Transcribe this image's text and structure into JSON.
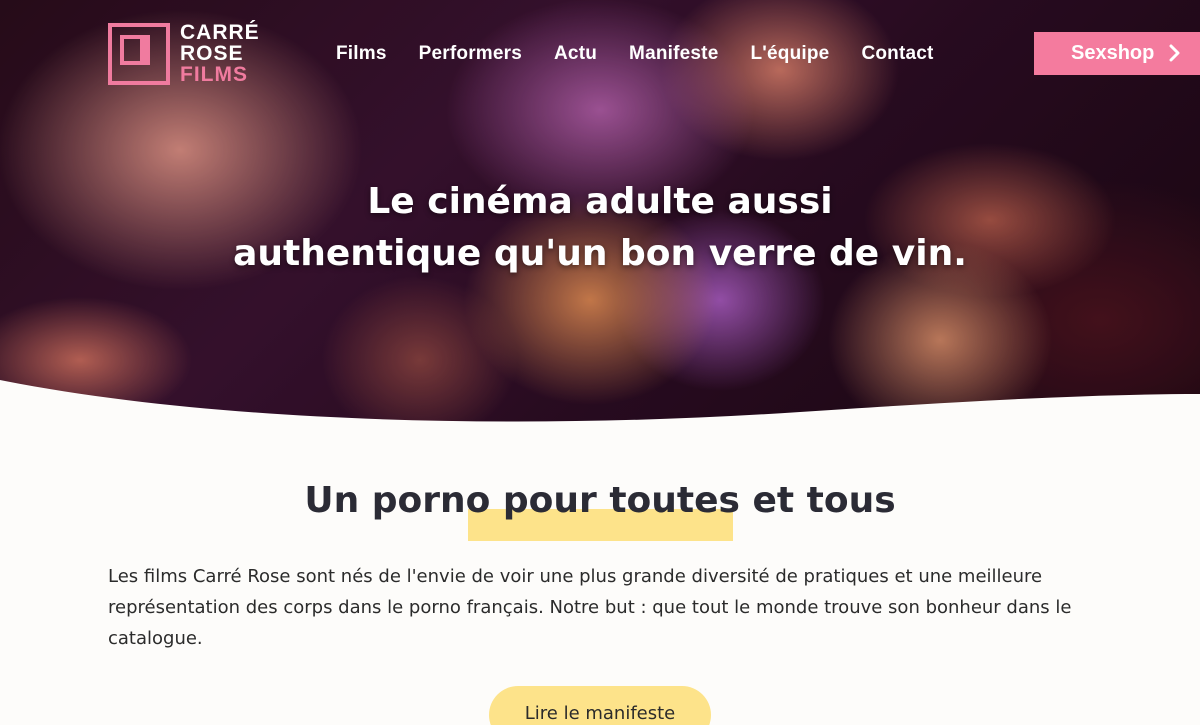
{
  "brand": {
    "line1": "CARRÉ",
    "line2": "ROSE",
    "line3": "FILMS",
    "accent_color": "#f47b9e"
  },
  "nav": {
    "items": [
      {
        "label": "Films"
      },
      {
        "label": "Performers"
      },
      {
        "label": "Actu"
      },
      {
        "label": "Manifeste"
      },
      {
        "label": "L'équipe"
      },
      {
        "label": "Contact"
      }
    ]
  },
  "shop_button": {
    "label": "Sexshop",
    "icon": "chevron-right-icon"
  },
  "hero": {
    "line1": "Le cinéma adulte aussi",
    "line2": "authentique qu'un bon verre de vin."
  },
  "section": {
    "title": "Un porno pour toutes et tous",
    "highlight_color": "#fde38a",
    "intro": "Les films Carré Rose sont nés de l'envie de voir une plus grande diversité de pratiques et une meilleure représentation des corps dans le porno français. Notre but : que tout le monde trouve son bonheur dans le catalogue.",
    "cta_label": "Lire le manifeste"
  }
}
